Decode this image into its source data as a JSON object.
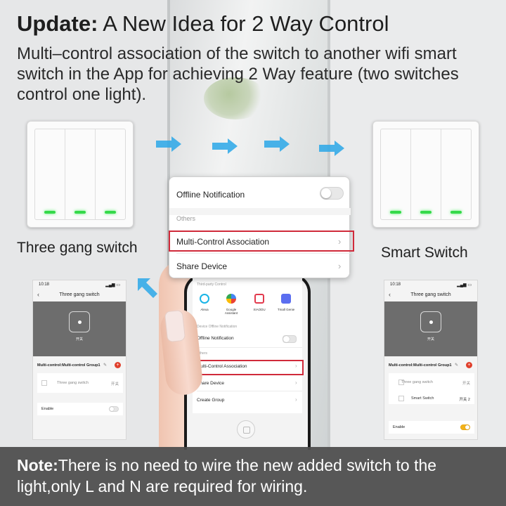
{
  "header": {
    "title_bold": "Update:",
    "title_rest": " A New Idea for 2 Way Control",
    "subtitle": "Multi–control association of the switch to another wifi smart switch in the App for achieving 2 Way feature (two switches control one light)."
  },
  "left_device": {
    "label": "Three gang switch"
  },
  "right_device": {
    "label": "Smart Switch"
  },
  "popup": {
    "offline_label": "Offline Notification",
    "others_label": "Others",
    "multi_label": "Multi-Control Association",
    "share_label": "Share Device",
    "offline_on": false
  },
  "phone_screen": {
    "third_party": "Third-party Control",
    "apps": [
      {
        "name": "Alexa",
        "color": "#19b4e6"
      },
      {
        "name": "Google Assistant",
        "color": "#4a86e8"
      },
      {
        "name": "XIAODU",
        "color": "#e23a4d"
      },
      {
        "name": "Tmall Genie",
        "color": "#5b6ef0"
      }
    ],
    "device_offline": "Device Offline Notification",
    "offline_label": "Offline Notification",
    "others": "Others",
    "multi_label": "Multi-Control Association",
    "share_label": "Share Device",
    "create_group": "Create Group"
  },
  "left_phone": {
    "time": "10:18",
    "title": "Three gang switch",
    "hero_label": "开关",
    "group_title": "Multi-control:Multi-control Group1",
    "device": "Three gang switch",
    "device_status": "开关",
    "enable_label": "Enable",
    "enable_on": false
  },
  "right_phone": {
    "time": "10:18",
    "title": "Three gang switch",
    "hero_label": "开关",
    "group_title": "Multi-control:Multi-control Group1",
    "device1": "Three gang switch",
    "device1_status": "开关",
    "device2": "Smart Switch",
    "device2_status": "开关 2",
    "enable_label": "Enable",
    "enable_on": true
  },
  "note": {
    "bold": "Note:",
    "text": "There is no need to wire the new added switch to the light,only L and N are required for wiring."
  },
  "colors": {
    "led_green": "#35d94a",
    "highlight_red": "#d02a3a",
    "arrow_blue": "#2aa7e8",
    "toggle_on": "#f3b21a",
    "note_bg": "#4e4e4e"
  }
}
